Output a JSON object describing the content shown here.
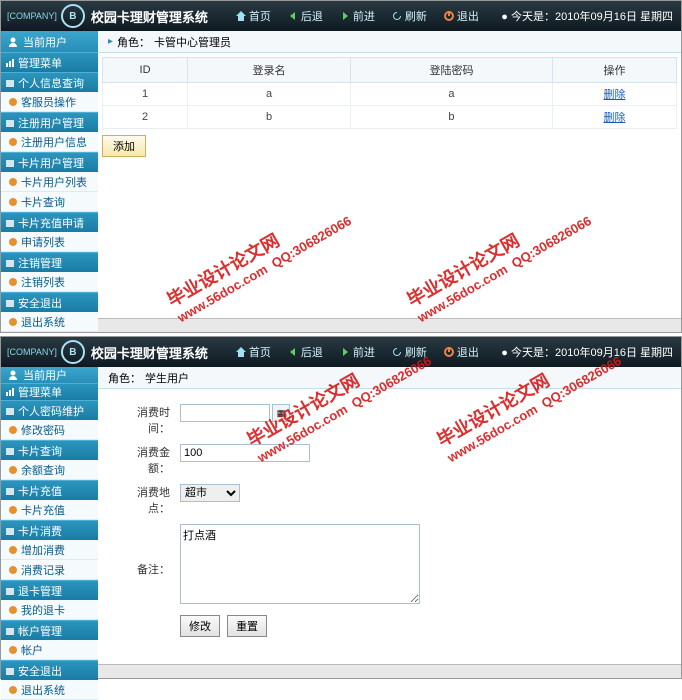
{
  "company_badge": "[COMPANY]",
  "app_title": "校园卡理财管理系统",
  "nav": {
    "home": "首页",
    "back": "后退",
    "forward": "前进",
    "refresh": "刷新",
    "logout": "退出"
  },
  "date_label": "今天是：",
  "date_value": "2010年09月16日 星期四",
  "screen1": {
    "current_user": "当前用户",
    "menu_title": "管理菜单",
    "groups": [
      {
        "name": "个人信息查询",
        "items": [
          "客服员操作"
        ]
      },
      {
        "name": "注册用户管理",
        "items": [
          "注册用户信息"
        ]
      },
      {
        "name": "卡片用户管理",
        "items": [
          "卡片用户列表",
          "卡片查询"
        ]
      },
      {
        "name": "卡片充值申请",
        "items": [
          "申请列表"
        ]
      },
      {
        "name": "注销管理",
        "items": [
          "注销列表"
        ]
      },
      {
        "name": "安全退出",
        "items": [
          "退出系统"
        ]
      }
    ],
    "role_label": "角色：",
    "role_value": "卡管中心管理员",
    "table": {
      "headers": [
        "ID",
        "登录名",
        "登陆密码",
        "操作"
      ],
      "rows": [
        {
          "id": "1",
          "login": "a",
          "pwd": "a",
          "op": "删除"
        },
        {
          "id": "2",
          "login": "b",
          "pwd": "b",
          "op": "删除"
        }
      ]
    },
    "add_btn": "添加"
  },
  "screen2": {
    "current_user": "当前用户",
    "menu_title": "管理菜单",
    "groups": [
      {
        "name": "个人密码维护",
        "items": [
          "修改密码"
        ]
      },
      {
        "name": "卡片查询",
        "items": [
          "余额查询"
        ]
      },
      {
        "name": "卡片充值",
        "items": [
          "卡片充值"
        ]
      },
      {
        "name": "卡片消费",
        "items": [
          "增加消费",
          "消费记录"
        ]
      },
      {
        "name": "退卡管理",
        "items": [
          "我的退卡"
        ]
      },
      {
        "name": "帐户管理",
        "items": [
          "帐户"
        ]
      },
      {
        "name": "安全退出",
        "items": [
          "退出系统"
        ]
      }
    ],
    "role_label": "角色：",
    "role_value": "学生用户",
    "form": {
      "time_label": "消费时间：",
      "time_value": "",
      "amount_label": "消费金额：",
      "amount_value": "100",
      "place_label": "消费地点：",
      "place_value": "超市",
      "remark_label": "备注：",
      "remark_value": "打点酒",
      "submit": "修改",
      "reset": "重置"
    }
  },
  "watermark": {
    "main": "毕业设计论文网",
    "url": "www.56doc.com",
    "qq": "QQ:306826066"
  }
}
